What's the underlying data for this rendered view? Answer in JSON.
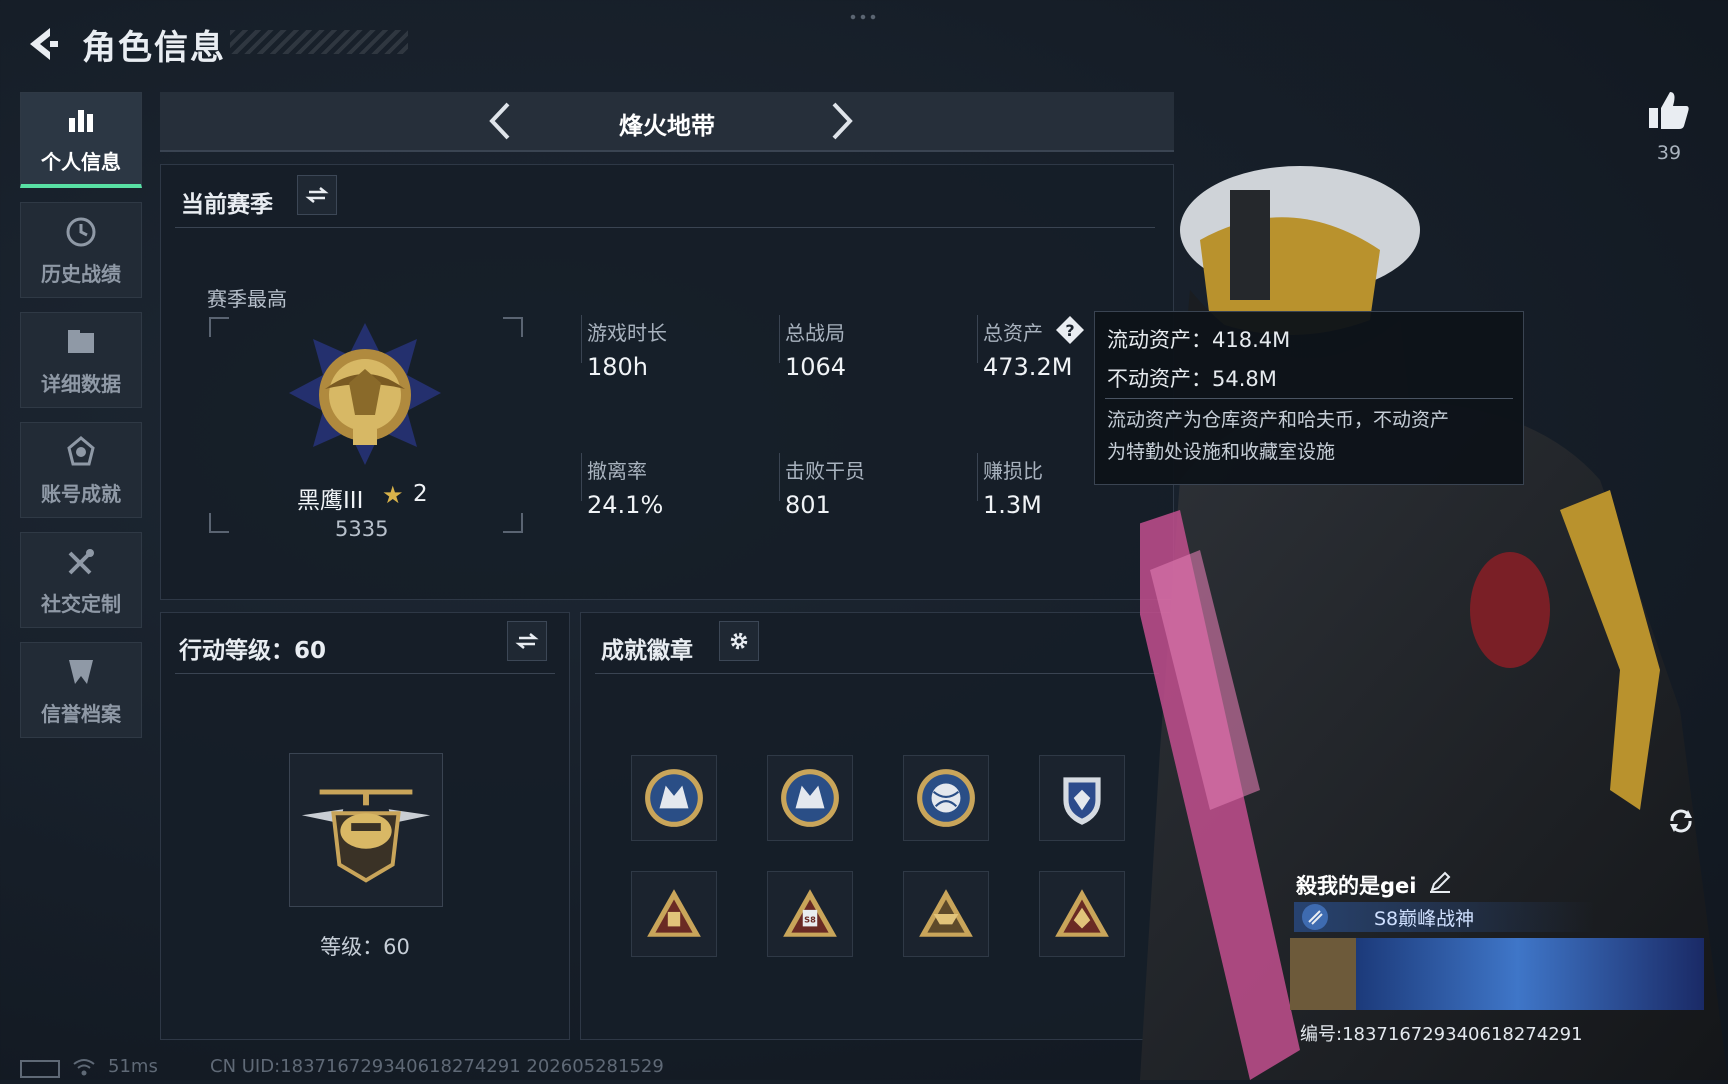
{
  "header": {
    "title": "角色信息"
  },
  "sidebar": {
    "items": [
      {
        "label": "个人信息",
        "icon": "bar-chart-icon",
        "active": true
      },
      {
        "label": "历史战绩",
        "icon": "clock-icon",
        "active": false
      },
      {
        "label": "详细数据",
        "icon": "folder-icon",
        "active": false
      },
      {
        "label": "账号成就",
        "icon": "medal-icon",
        "active": false
      },
      {
        "label": "社交定制",
        "icon": "tools-icon",
        "active": false
      },
      {
        "label": "信誉档案",
        "icon": "shield-icon",
        "active": false
      }
    ]
  },
  "mode": {
    "title": "烽火地带"
  },
  "season": {
    "header": "当前赛季",
    "best_label": "赛季最高",
    "rank_name": "黑鹰III",
    "rank_stars": "2",
    "rank_score": "5335",
    "stats": [
      {
        "label": "游戏时长",
        "value": "180h"
      },
      {
        "label": "总战局",
        "value": "1064"
      },
      {
        "label": "总资产",
        "value": "473.2M"
      },
      {
        "label": "撤离率",
        "value": "24.1%"
      },
      {
        "label": "击败干员",
        "value": "801"
      },
      {
        "label": "赚损比",
        "value": "1.3M"
      }
    ]
  },
  "tooltip": {
    "liquid": "流动资产：418.4M",
    "fixed": "不动资产：54.8M",
    "note_line1": "流动资产为仓库资产和哈夫币，不动资产",
    "note_line2": "为特勤处设施和收藏室设施"
  },
  "action_level": {
    "header": "行动等级：60",
    "level_text": "等级：60"
  },
  "achievements": {
    "header": "成就徽章",
    "badges": [
      "wolf-badge-icon",
      "wolf-badge-icon",
      "ball-badge-icon",
      "shield-badge-icon",
      "triangle-badge-icon",
      "triangle-badge-icon",
      "triangle-badge-icon",
      "triangle-badge-icon"
    ]
  },
  "like": {
    "count": "39"
  },
  "profile": {
    "name": "殺我的是gei",
    "title": "S8巅峰战神",
    "id_label": "编号:183716729340618274291"
  },
  "status": {
    "ping": "51ms",
    "uid_line": "CN UID:183716729340618274291 202605281529"
  },
  "colors": {
    "accent": "#58e0a4",
    "gold": "#d8b24a",
    "bg": "#161e28"
  }
}
